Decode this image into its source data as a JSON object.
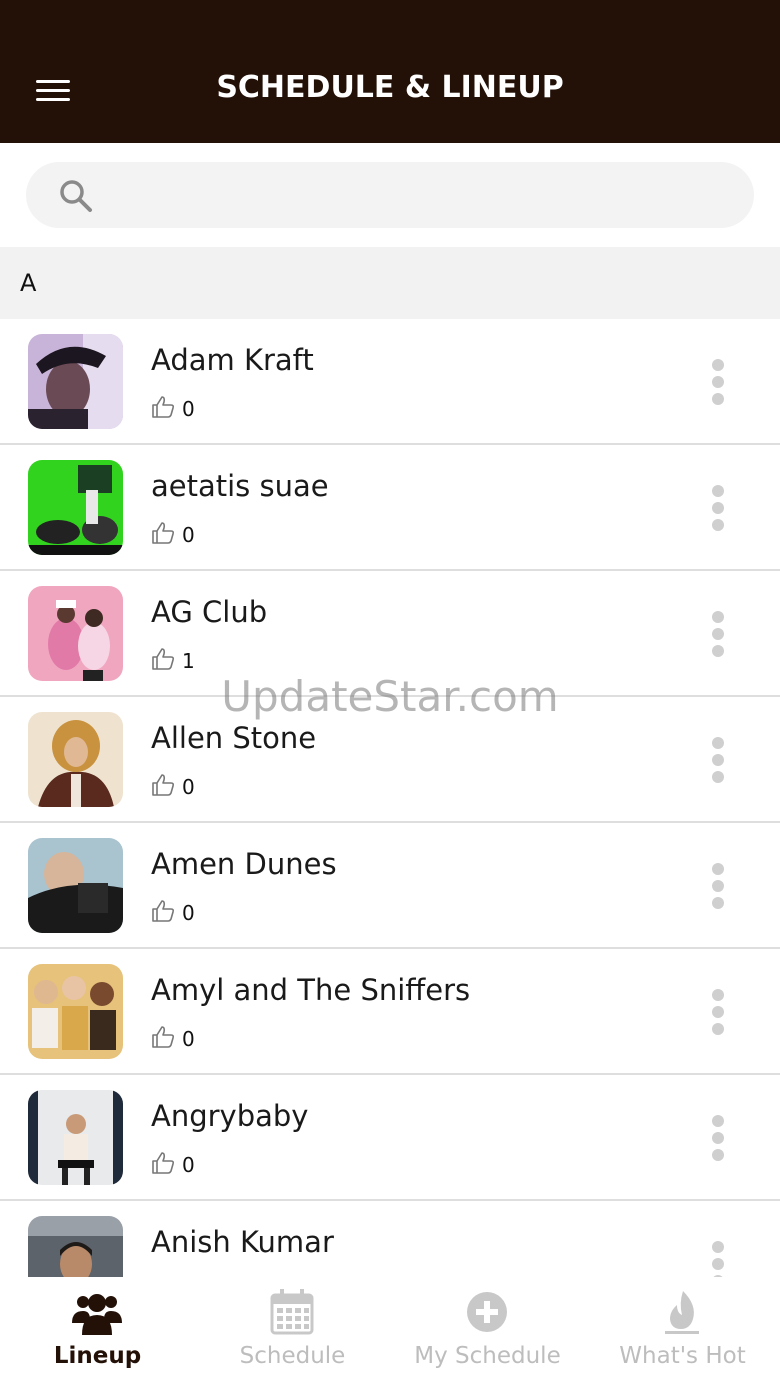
{
  "header": {
    "title": "SCHEDULE & LINEUP",
    "menu_icon": "hamburger-menu-icon",
    "background": "#231108"
  },
  "search": {
    "placeholder": "",
    "value": "",
    "icon": "search-icon"
  },
  "section": {
    "letter": "A"
  },
  "artists": [
    {
      "name": "Adam Kraft",
      "likes": "0"
    },
    {
      "name": "aetatis suae",
      "likes": "0"
    },
    {
      "name": "AG Club",
      "likes": "1"
    },
    {
      "name": "Allen Stone",
      "likes": "0"
    },
    {
      "name": "Amen Dunes",
      "likes": "0"
    },
    {
      "name": "Amyl and The Sniffers",
      "likes": "0"
    },
    {
      "name": "Angrybaby",
      "likes": "0"
    },
    {
      "name": "Anish Kumar",
      "likes": ""
    }
  ],
  "watermark": "UpdateStar.com",
  "tabs": [
    {
      "label": "Lineup",
      "icon": "users-icon",
      "active": true
    },
    {
      "label": "Schedule",
      "icon": "calendar-icon",
      "active": false
    },
    {
      "label": "My Schedule",
      "icon": "plus-circle-icon",
      "active": false
    },
    {
      "label": "What's Hot",
      "icon": "flame-icon",
      "active": false
    }
  ],
  "colors": {
    "brand": "#231108",
    "inactive_tab": "#bdbdbd",
    "section_bg": "#f2f2f2"
  }
}
